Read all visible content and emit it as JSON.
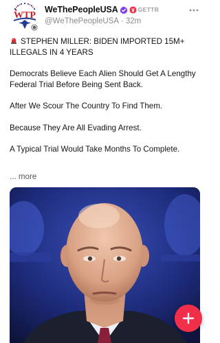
{
  "post": {
    "author": {
      "display_name": "WeThePeopleUSA",
      "handle": "@WeThePeopleUSA",
      "timestamp": "32m",
      "platform_badge": "GETTR",
      "avatar_text": "WTP"
    },
    "body": {
      "headline": "STEPHEN MILLER: BIDEN IMPORTED 15M+ ILLEGALS IN 4 YEARS",
      "paragraphs": [
        "Democrats Believe Each Alien Should Get A Lengthy Federal Trial Before Being Sent Back.",
        "After We Scour The Country To Find Them.",
        "Because They Are All Evading Arrest.",
        "A Typical Trial Would Take Months To Complete."
      ],
      "more_label": "... more"
    },
    "media": {
      "type": "photo",
      "subject": "portrait"
    }
  },
  "icons": {
    "verified": "verified-badge-icon",
    "gettr": "gettr-logo-icon",
    "siren": "siren-emoji-icon",
    "more": "more-horizontal-icon",
    "compose": "plus-icon"
  },
  "colors": {
    "accent": "#f22f4a",
    "verified": "#7b3ff2",
    "muted_text": "#8a8a8a"
  }
}
